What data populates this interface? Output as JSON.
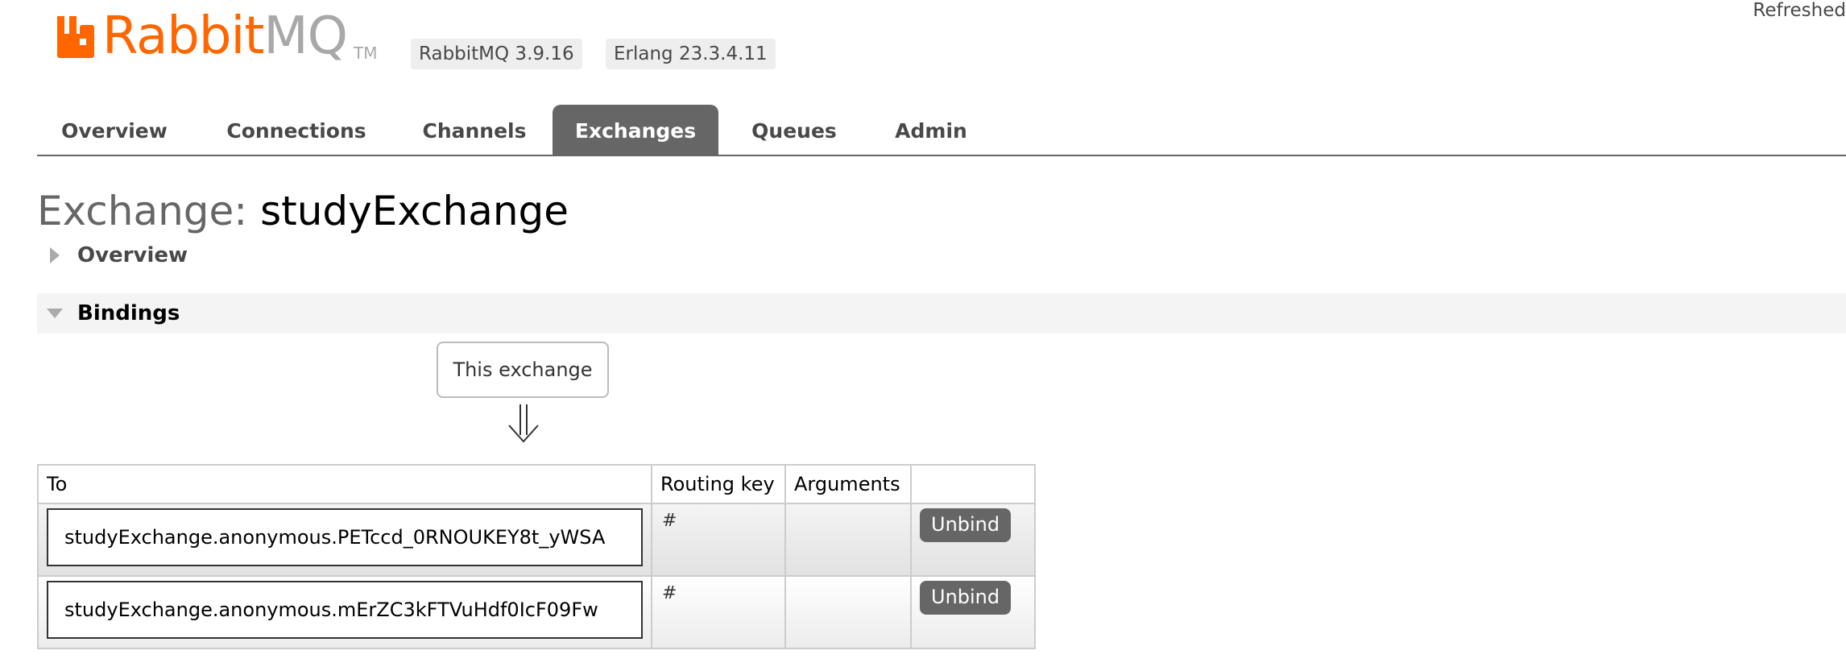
{
  "header": {
    "logo_rabbit": "Rabbit",
    "logo_mq": "MQ",
    "logo_tm": "TM",
    "rabbitmq_version": "RabbitMQ 3.9.16",
    "erlang_version": "Erlang 23.3.4.11",
    "refreshed_label": "Refreshed"
  },
  "nav": {
    "tabs": [
      {
        "label": "Overview",
        "active": false
      },
      {
        "label": "Connections",
        "active": false
      },
      {
        "label": "Channels",
        "active": false
      },
      {
        "label": "Exchanges",
        "active": true
      },
      {
        "label": "Queues",
        "active": false
      },
      {
        "label": "Admin",
        "active": false
      }
    ]
  },
  "page": {
    "title_prefix": "Exchange:",
    "exchange_name": "studyExchange"
  },
  "sections": {
    "overview": {
      "label": "Overview",
      "expanded": false
    },
    "bindings": {
      "label": "Bindings",
      "expanded": true
    }
  },
  "bindings": {
    "this_exchange_label": "This exchange",
    "columns": [
      "To",
      "Routing key",
      "Arguments",
      ""
    ],
    "rows": [
      {
        "to": "studyExchange.anonymous.PETccd_0RNOUKEY8t_yWSA",
        "routing_key": "#",
        "arguments": "",
        "action": "Unbind"
      },
      {
        "to": "studyExchange.anonymous.mErZC3kFTVuHdf0IcF09Fw",
        "routing_key": "#",
        "arguments": "",
        "action": "Unbind"
      }
    ]
  },
  "colors": {
    "brand_orange": "#ff6600",
    "tab_active_bg": "#666666",
    "button_bg": "#666666"
  },
  "icons": {
    "logo": "rabbitmq-logo-icon",
    "collapsed_toggle": "triangle-right-icon",
    "expanded_toggle": "triangle-down-icon",
    "flow_arrow": "double-down-arrow-icon"
  }
}
